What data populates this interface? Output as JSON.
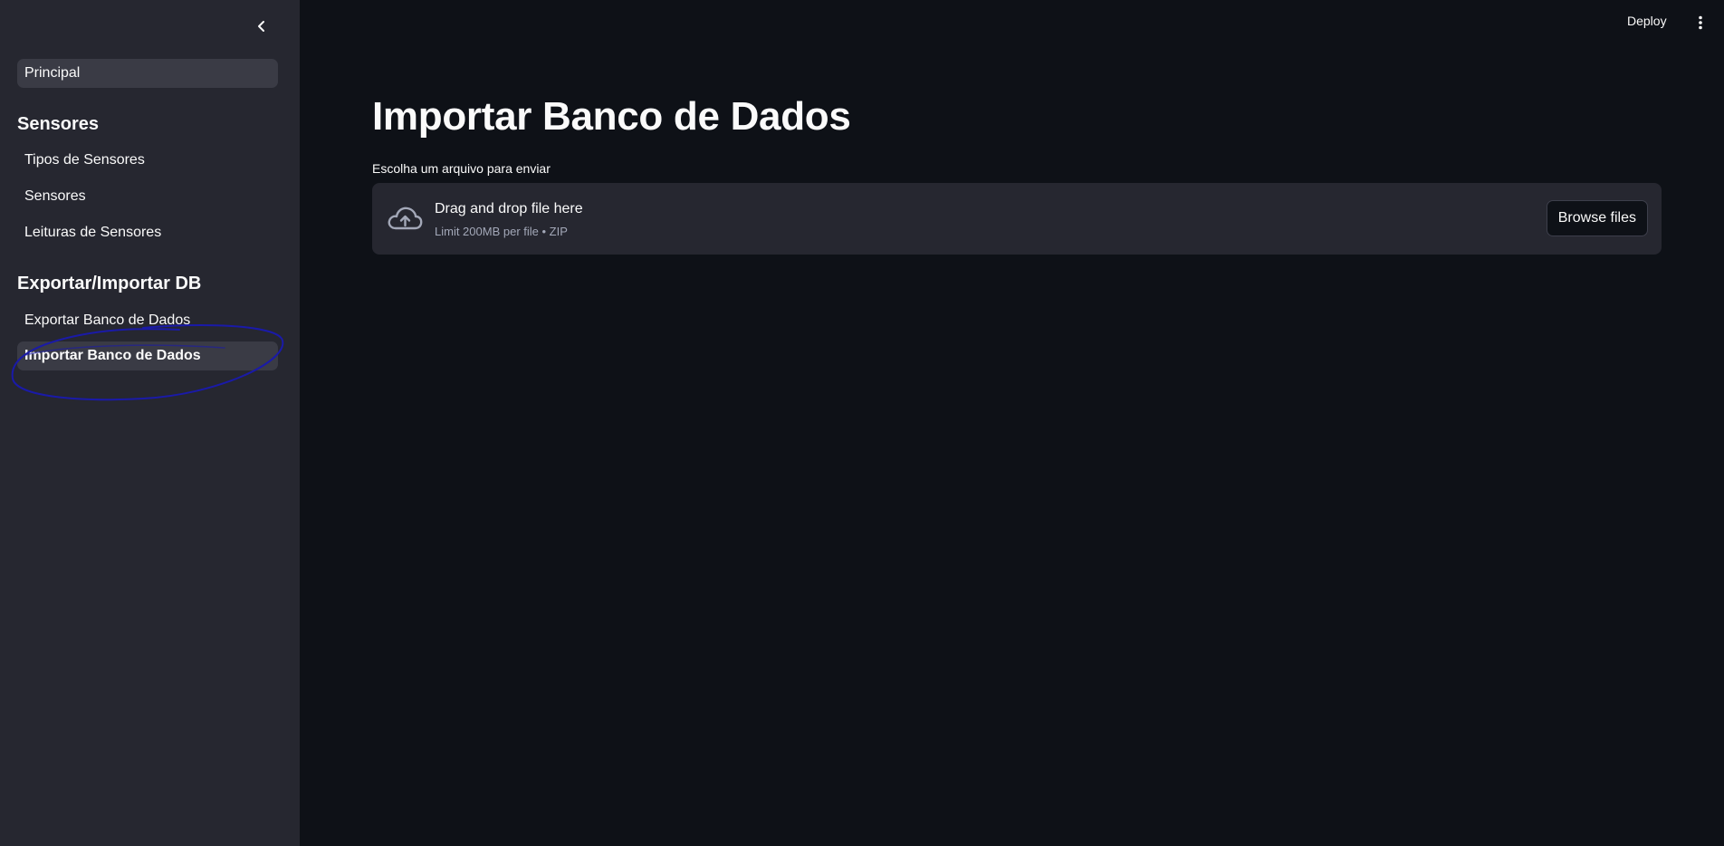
{
  "sidebar": {
    "collapse_icon": "chevron-left-icon",
    "top_item": {
      "label": "Principal"
    },
    "sections": [
      {
        "header": "Sensores",
        "items": [
          {
            "label": "Tipos de Sensores"
          },
          {
            "label": "Sensores"
          },
          {
            "label": "Leituras de Sensores"
          }
        ]
      },
      {
        "header": "Exportar/Importar DB",
        "items": [
          {
            "label": "Exportar Banco de Dados"
          },
          {
            "label": "Importar Banco de Dados",
            "active": true
          }
        ]
      }
    ]
  },
  "header": {
    "deploy_label": "Deploy",
    "menu_icon": "kebab-menu-icon"
  },
  "main": {
    "title": "Importar Banco de Dados",
    "uploader": {
      "label": "Escolha um arquivo para enviar",
      "drop_text": "Drag and drop file here",
      "limit_text": "Limit 200MB per file • ZIP",
      "browse_label": "Browse files",
      "icon": "cloud-upload-icon"
    }
  },
  "colors": {
    "sidebar_bg": "#262730",
    "main_bg": "#0e1117",
    "active_item_bg": "#3a3b45",
    "annotation_stroke": "#1a1aa8",
    "muted_text": "#a3a8b8"
  }
}
